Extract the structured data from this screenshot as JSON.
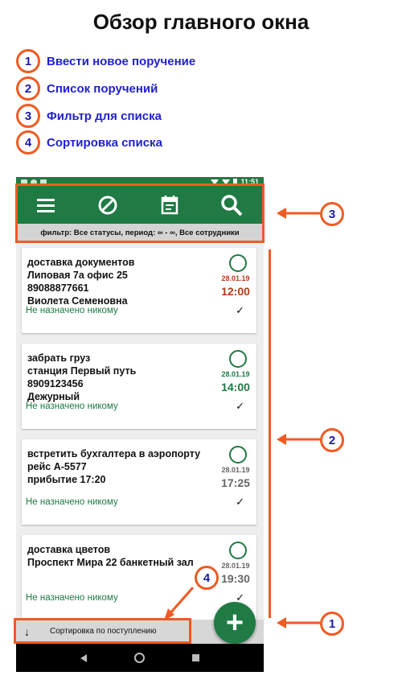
{
  "header": {
    "title": "Обзор главного окна"
  },
  "legend": [
    {
      "num": "1",
      "text": "Ввести новое поручение"
    },
    {
      "num": "2",
      "text": "Список поручений"
    },
    {
      "num": "3",
      "text": "Фильтр для списка"
    },
    {
      "num": "4",
      "text": "Сортировка списка"
    }
  ],
  "phone": {
    "status_time": "11:51",
    "filter_text": "фильтр: Все статусы, период: ∞ - ∞, Все сотрудники",
    "tasks": [
      {
        "lines": [
          "доставка документов",
          "Липовая 7а офис 25",
          "89088877661",
          "Виолета Семеновна"
        ],
        "date": "28.01.19",
        "time": "12:00",
        "time_color": "#b5391a",
        "assigned": "Не назначено никому",
        "tick": "✓"
      },
      {
        "lines": [
          "забрать груз",
          "станция Первый путь",
          "8909123456",
          "Дежурный"
        ],
        "date": "28.01.19",
        "time": "14:00",
        "time_color": "#1f7a44",
        "assigned": "Не назначено никому",
        "tick": "✓"
      },
      {
        "lines": [
          "встретить бухгалтера в аэропорту",
          "рейс А-5577",
          "прибытие 17:20"
        ],
        "date": "28.01.19",
        "time": "17:25",
        "time_color": "#666666",
        "assigned": "Не назначено никому",
        "tick": "✓"
      },
      {
        "lines": [
          "доставка цветов",
          "Проспект Мира 22 банкетный зал"
        ],
        "date": "28.01.19",
        "time": "19:30",
        "time_color": "#666666",
        "assigned": "Не назначено никому",
        "tick": "✓"
      }
    ],
    "sort_arrow": "↓",
    "sort_label": "Сортировка по поступлению",
    "fab_label": "+"
  },
  "annotations": {
    "badge1": "1",
    "badge2": "2",
    "badge3": "3",
    "badge4": "4"
  },
  "colors": {
    "accent": "#f05a22",
    "brand_green": "#1f7a44",
    "legend_text": "#1f1fd1"
  },
  "icons": [
    "menu-icon",
    "block-icon",
    "calendar-icon",
    "search-icon",
    "check-circle-icon",
    "checkmark-icon",
    "sort-arrow-icon",
    "add-icon"
  ]
}
